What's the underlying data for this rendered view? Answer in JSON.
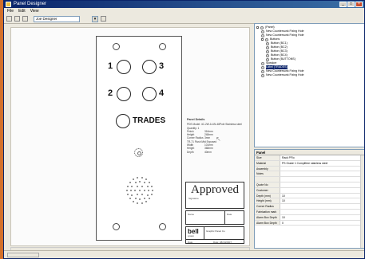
{
  "window": {
    "title": "Panel Designer",
    "controls": [
      "_",
      "□",
      "×"
    ]
  },
  "menu": [
    "File",
    "Edit",
    "View"
  ],
  "toolbar": {
    "combo_value": "Joe Designer",
    "icons": [
      "new-icon",
      "save-icon",
      "print-icon",
      "settings-icon"
    ]
  },
  "panel": {
    "buttons": [
      "1",
      "3",
      "2",
      "4"
    ],
    "trades_label": "TRADES"
  },
  "details": {
    "heading": "Panel Details",
    "lines": [
      "PDS Model: 4C-2W-14-BI-48Pole Stainless steel",
      "Quantity: 1"
    ],
    "rows": [
      {
        "k": "Finish",
        "v": "316mm"
      },
      {
        "k": "Height",
        "v": "248mm"
      },
      {
        "k": "Corner Radius",
        "v": "3mm"
      }
    ],
    "line2": "TR-71 Flush Mtd Exposed",
    "rows2": [
      {
        "k": "Width",
        "v": "101mm"
      },
      {
        "k": "Height",
        "v": "368mm"
      },
      {
        "k": "Depth",
        "v": "40mm"
      }
    ]
  },
  "stamp": {
    "title": "Approved",
    "signature_label": "Signature",
    "name_label": "Name",
    "date_label": "Date"
  },
  "titleblock": {
    "logo": "bell",
    "logo_sub": "system",
    "name": "Graphic Panel Co",
    "date_label": "Date",
    "date_value": "Date: 08/10/2007"
  },
  "tree": {
    "items": [
      {
        "label": "(Panel)",
        "indent": 0,
        "expander": "-"
      },
      {
        "label": "New Countersunk Fixing Hole",
        "indent": 1
      },
      {
        "label": "New Countersunk Fixing Hole",
        "indent": 1
      },
      {
        "label": "Buttons",
        "indent": 1,
        "expander": "-"
      },
      {
        "label": "Button (BC1)",
        "indent": 2
      },
      {
        "label": "Button (BC2)",
        "indent": 2
      },
      {
        "label": "Button (BC3)",
        "indent": 2
      },
      {
        "label": "Button (BC4)",
        "indent": 2
      },
      {
        "label": "Button (BUTTONS)",
        "indent": 2
      },
      {
        "label": "Speaker",
        "indent": 1
      },
      {
        "label": "Label (TRADES)",
        "indent": 1,
        "selected": true
      },
      {
        "label": "New Countersunk Fixing Hole",
        "indent": 1
      },
      {
        "label": "New Countersunk Fixing Hole",
        "indent": 1
      }
    ]
  },
  "properties": {
    "header": "Panel",
    "rows": [
      {
        "k": "Size",
        "v": "Rack PFlo"
      },
      {
        "k": "Material",
        "v": "PS Grade 1 Complifree stainless steel"
      },
      {
        "k": "Assembly",
        "v": ""
      },
      {
        "k": "Notes",
        "v": ""
      },
      {
        "k": "",
        "v": ""
      },
      {
        "k": "Quote No",
        "v": ""
      },
      {
        "k": "Customer",
        "v": ""
      },
      {
        "k": "Depth (mm)",
        "v": "10"
      },
      {
        "k": "Height (mm)",
        "v": "10"
      },
      {
        "k": "Corner Radius",
        "v": ""
      },
      {
        "k": "Fabrication mark",
        "v": ""
      },
      {
        "k": "Alarm Box Depth",
        "v": "10"
      },
      {
        "k": "Alarm Box Depth",
        "v": "0"
      }
    ]
  },
  "status": {
    "text": ""
  }
}
